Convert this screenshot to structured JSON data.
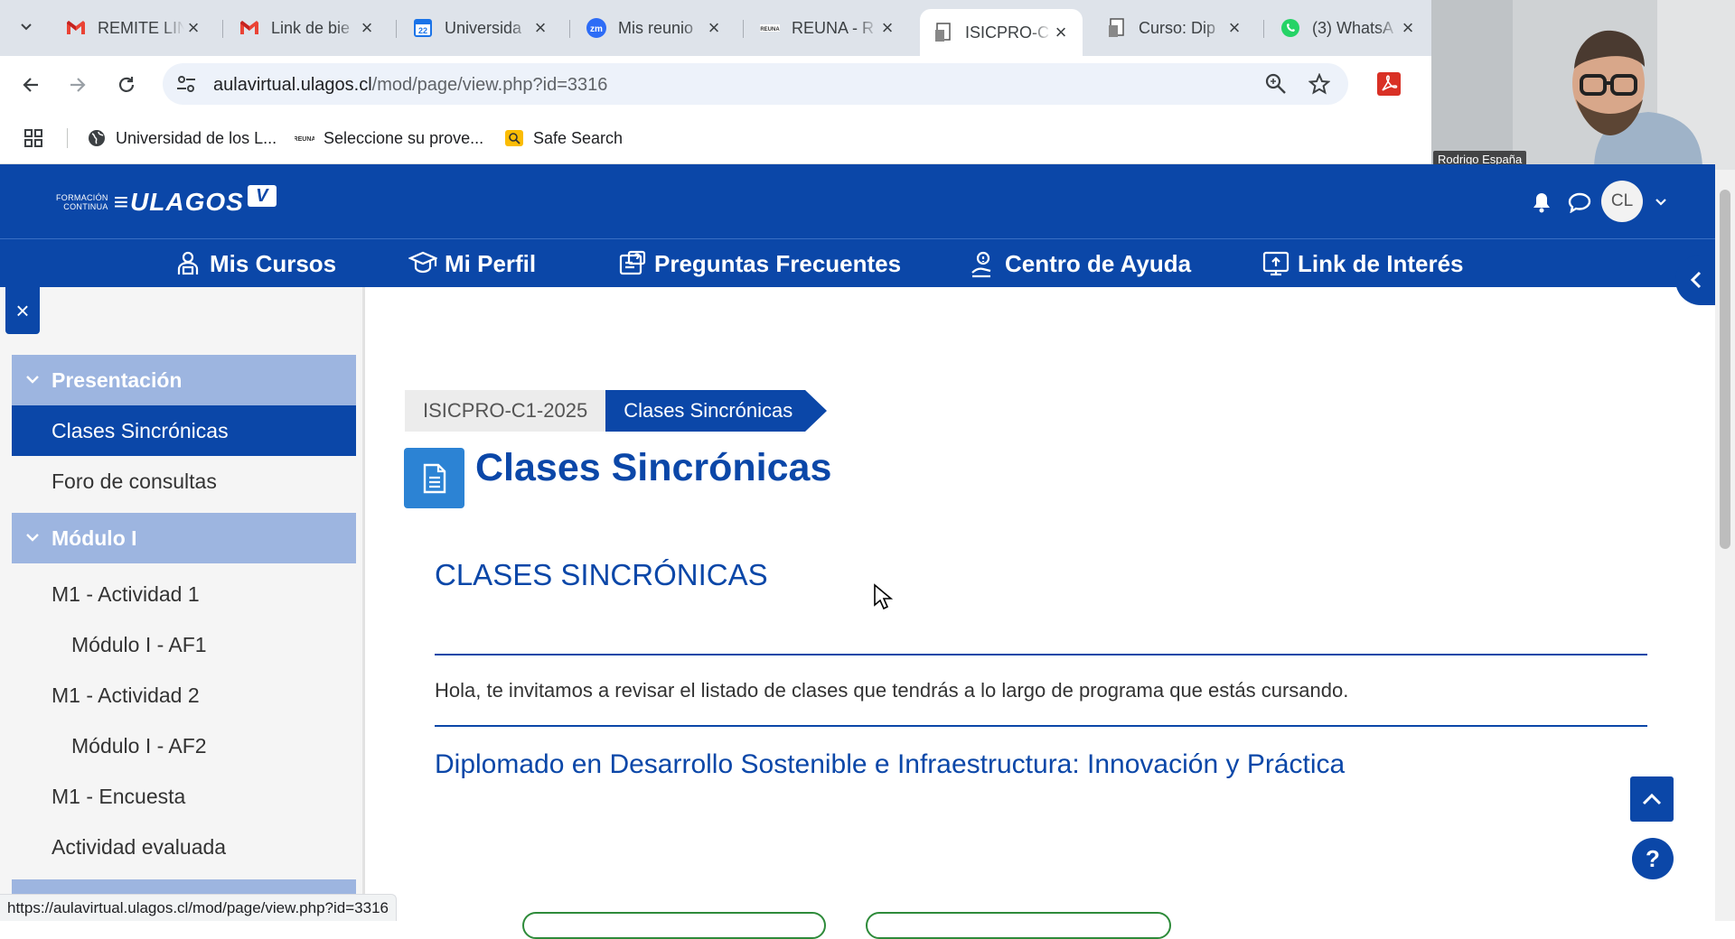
{
  "browser": {
    "tabs": [
      {
        "title": "REMITE LIN",
        "favicon": "gmail-icon",
        "active": false
      },
      {
        "title": "Link de bie",
        "favicon": "gmail-icon",
        "active": false
      },
      {
        "title": "Universida",
        "favicon": "calendar-icon",
        "active": false
      },
      {
        "title": "Mis reunio",
        "favicon": "zoom-icon",
        "active": false
      },
      {
        "title": "REUNA - R",
        "favicon": "reuna-icon",
        "active": false
      },
      {
        "title": "ISICPRO-C",
        "favicon": "moodle-page-icon",
        "active": true
      },
      {
        "title": "Curso: Dip",
        "favicon": "moodle-page-icon",
        "active": false
      },
      {
        "title": "(3) WhatsA",
        "favicon": "whatsapp-icon",
        "active": false
      }
    ],
    "address": {
      "host": "aulavirtual.ulagos.cl",
      "path": "/mod/page/view.php?id=3316"
    },
    "bookmarks": [
      {
        "label": "Universidad de los L...",
        "icon": "globe-icon"
      },
      {
        "label": "Seleccione su prove...",
        "icon": "reuna-icon"
      },
      {
        "label": "Safe Search",
        "icon": "safe-search-icon"
      }
    ],
    "status_url": "https://aulavirtual.ulagos.cl/mod/page/view.php?id=3316"
  },
  "video": {
    "participant_name": "Rodrigo España"
  },
  "site": {
    "logo": {
      "small_line1": "FORMACIÓN",
      "small_line2": "CONTINUA",
      "brand": "ULAGOS",
      "badge": "V"
    },
    "user_initials": "CL",
    "nav": [
      {
        "label": "Mis Cursos",
        "icon": "courses-icon"
      },
      {
        "label": "Mi Perfil",
        "icon": "profile-icon"
      },
      {
        "label": "Preguntas Frecuentes",
        "icon": "faq-icon"
      },
      {
        "label": "Centro de Ayuda",
        "icon": "help-center-icon"
      },
      {
        "label": "Link de Interés",
        "icon": "links-icon"
      }
    ]
  },
  "sidebar": {
    "close_label": "×",
    "sections": [
      {
        "label": "Presentación"
      },
      {
        "label": "Módulo I"
      }
    ],
    "items": [
      {
        "label": "Clases Sincrónicas",
        "active": true
      },
      {
        "label": "Foro de consultas"
      },
      {
        "label": "M1 - Actividad 1"
      },
      {
        "label": "Módulo I - AF1"
      },
      {
        "label": "M1 - Actividad 2"
      },
      {
        "label": "Módulo I - AF2"
      },
      {
        "label": "M1 - Encuesta"
      },
      {
        "label": "Actividad evaluada"
      }
    ]
  },
  "content": {
    "breadcrumb": [
      "ISICPRO-C1-2025",
      "Clases Sincrónicas"
    ],
    "page_title": "Clases Sincrónicas",
    "heading": "CLASES SINCRÓNICAS",
    "intro": "Hola, te invitamos a revisar el listado de clases que tendrás a lo largo de programa que estás cursando.",
    "program_title": "Diplomado en Desarrollo Sostenible e Infraestructura: Innovación y Práctica"
  },
  "floating": {
    "help_label": "?"
  },
  "colors": {
    "primary": "#0b47a8",
    "section_header": "#9db5e0",
    "page_icon": "#2c83d4",
    "chrome_tabbar": "#dee3ea"
  }
}
